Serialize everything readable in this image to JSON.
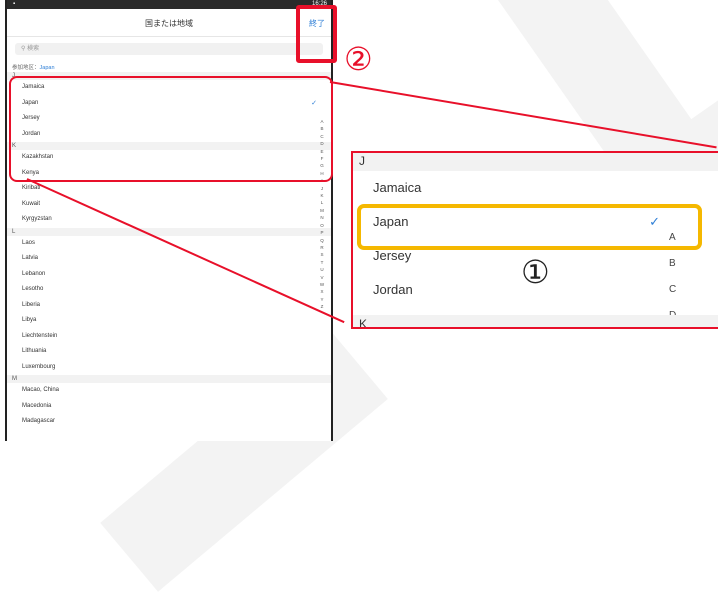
{
  "status_bar": {
    "time": "16:26"
  },
  "nav": {
    "title": "国または地域",
    "done": "終了"
  },
  "search": {
    "placeholder": "検索"
  },
  "current": {
    "label": "参加地区：",
    "value": "Japan"
  },
  "sections": [
    {
      "letter": "J",
      "items": [
        "Jamaica",
        "Japan",
        "Jersey",
        "Jordan"
      ]
    },
    {
      "letter": "K",
      "items": [
        "Kazakhstan",
        "Kenya",
        "Kiribati",
        "Kuwait",
        "Kyrgyzstan"
      ]
    },
    {
      "letter": "L",
      "items": [
        "Laos",
        "Latvia",
        "Lebanon",
        "Lesotho",
        "Liberia",
        "Libya",
        "Liechtenstein",
        "Lithuania",
        "Luxembourg"
      ]
    },
    {
      "letter": "M",
      "items": [
        "Macao, China",
        "Macedonia",
        "Madagascar"
      ]
    }
  ],
  "selected": "Japan",
  "index": [
    "A",
    "B",
    "C",
    "D",
    "E",
    "F",
    "G",
    "H",
    "I",
    "J",
    "K",
    "L",
    "M",
    "N",
    "O",
    "P",
    "Q",
    "R",
    "S",
    "T",
    "U",
    "V",
    "W",
    "X",
    "Y",
    "Z"
  ],
  "zoom": {
    "header": "J",
    "items": [
      "Jamaica",
      "Japan",
      "Jersey",
      "Jordan"
    ],
    "index": [
      "A",
      "B",
      "C",
      "D"
    ],
    "next_header": "K"
  },
  "annotations": {
    "step1": "①",
    "step2": "②"
  },
  "colors": {
    "accent": "#2f7fd6",
    "annotation_red": "#e8102a",
    "highlight_orange": "#f5b800"
  }
}
